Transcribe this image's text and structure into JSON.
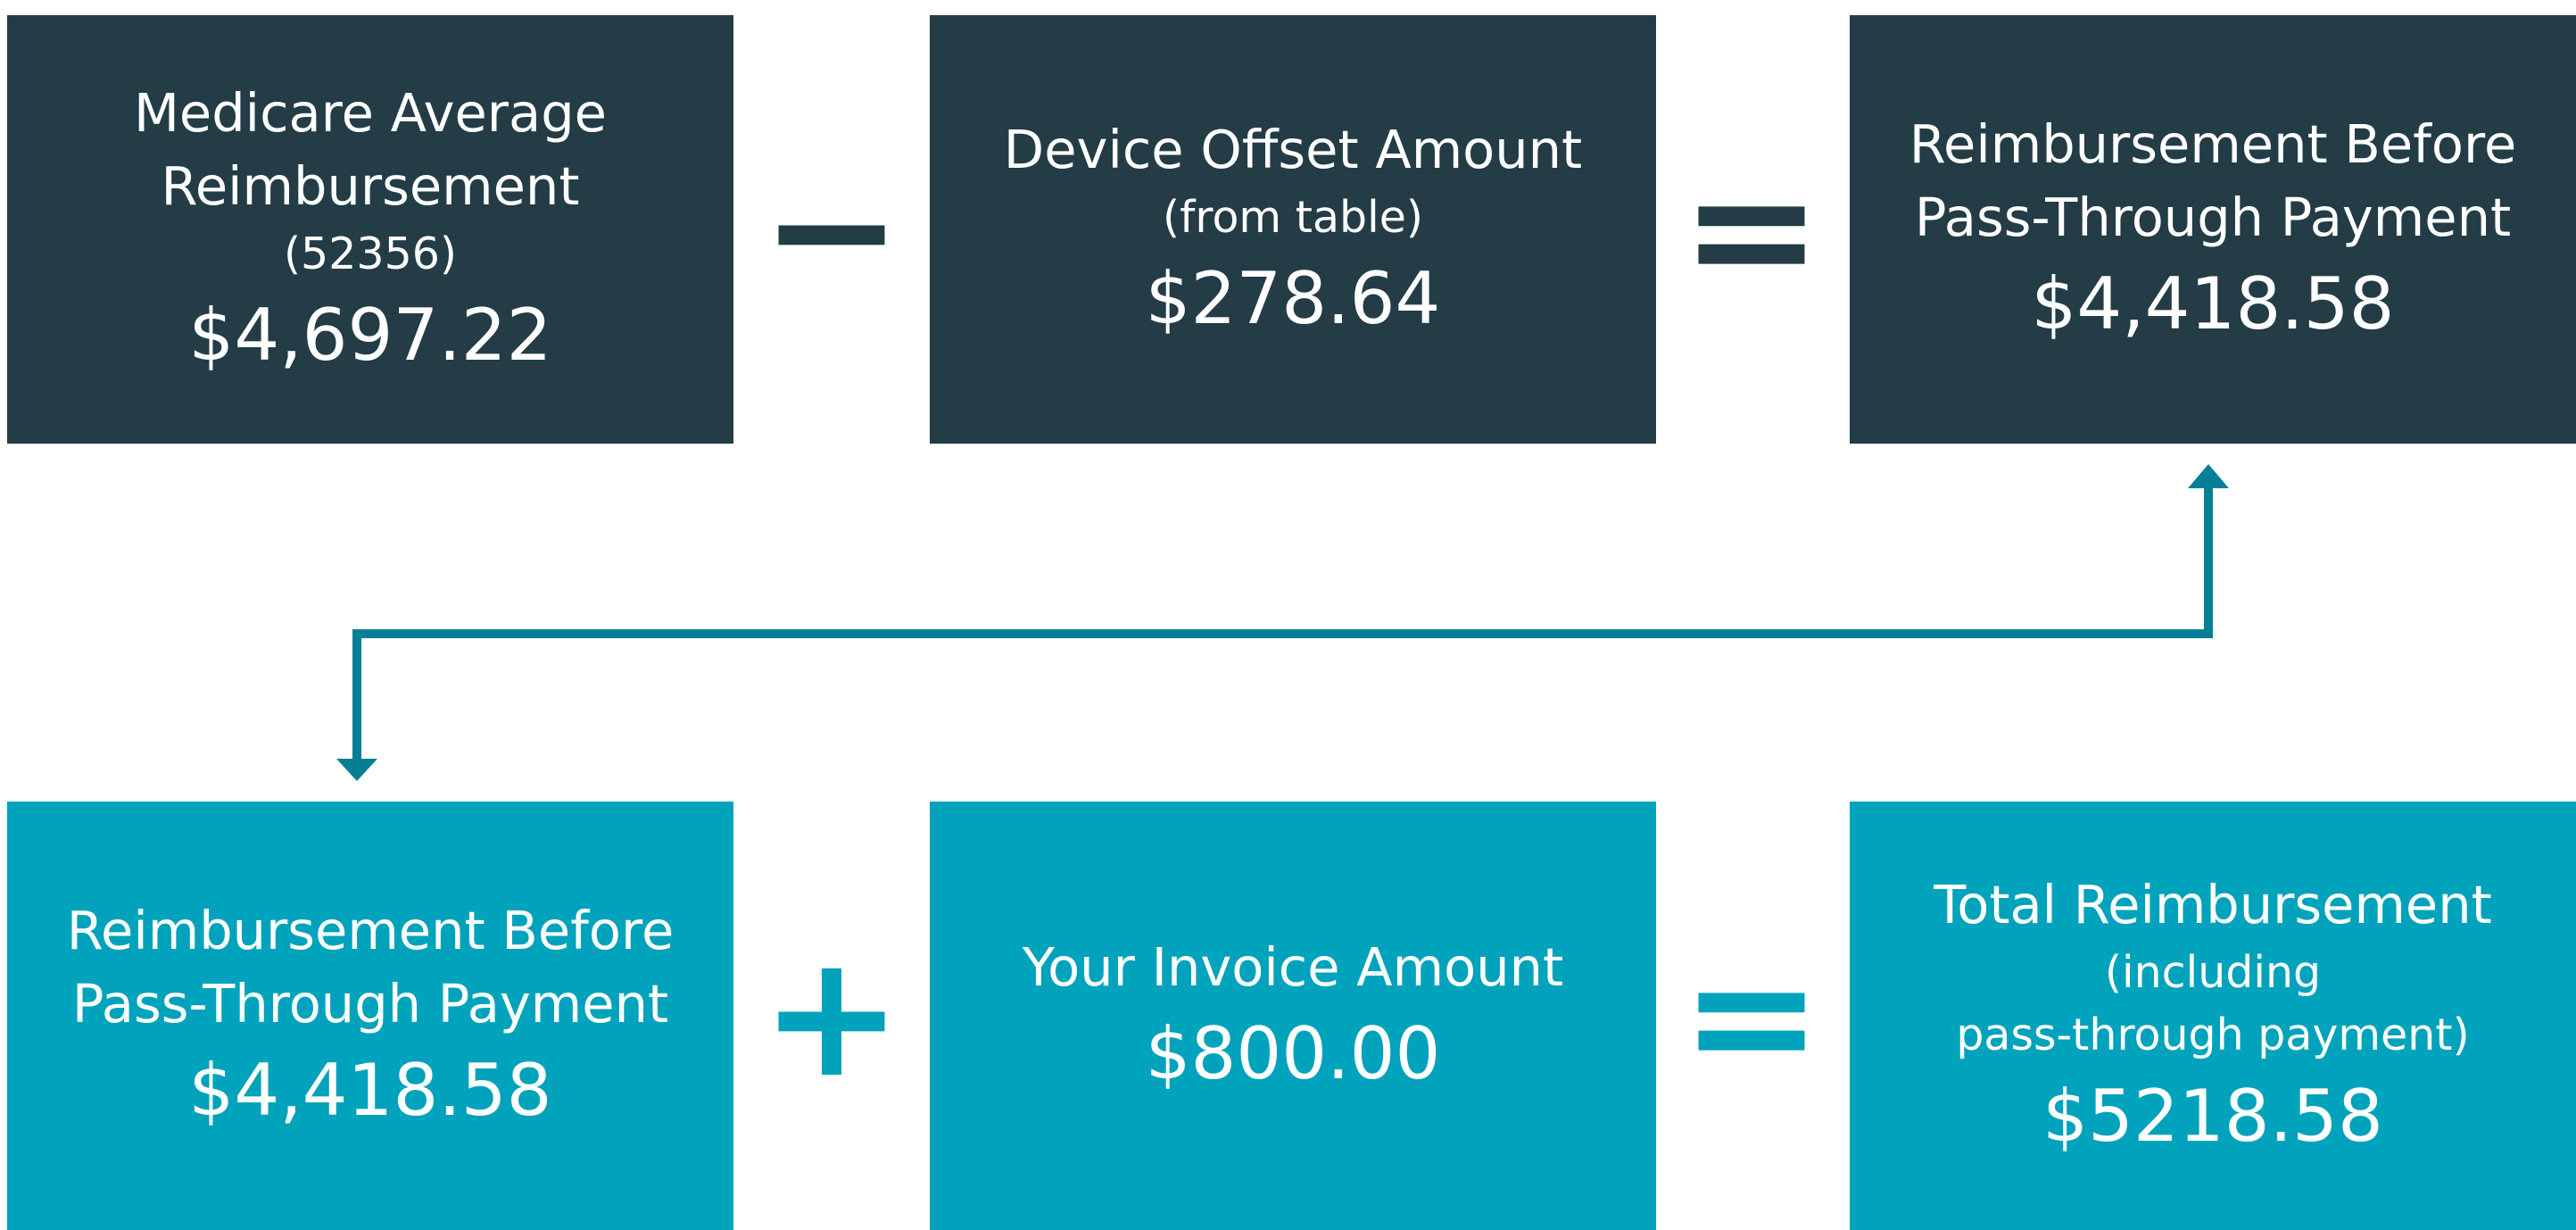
{
  "colors": {
    "dark": "#233c46",
    "teal": "#00a3bb",
    "arrow": "#047f96"
  },
  "row1": {
    "box1": {
      "label": "Medicare Average\nReimbursement",
      "sub": "(52356)",
      "amount": "$4,697.22"
    },
    "op1": "−",
    "box2": {
      "label": "Device Offset Amount",
      "sub": "(from table)",
      "amount": "$278.64"
    },
    "op2": "=",
    "box3": {
      "label": "Reimbursement Before\nPass-Through Payment",
      "amount": "$4,418.58"
    }
  },
  "row2": {
    "box1": {
      "label": "Reimbursement Before\nPass-Through Payment",
      "amount": "$4,418.58"
    },
    "op1": "+",
    "box2": {
      "label": "Your Invoice Amount",
      "amount": "$800.00"
    },
    "op2": "=",
    "box3": {
      "label": "Total Reimbursement",
      "sub": "(including\npass-through payment)",
      "amount": "$5218.58"
    }
  }
}
